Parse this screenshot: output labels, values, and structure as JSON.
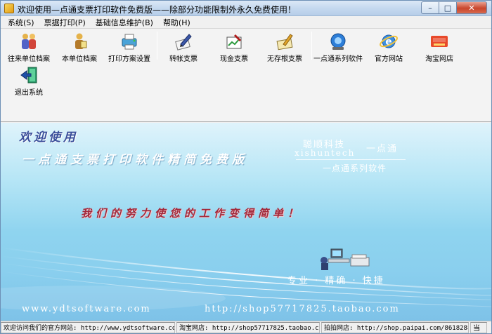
{
  "window": {
    "title": "欢迎使用—点通支票打印软件免费版——除部分功能限制外永久免费使用！",
    "min_glyph": "–",
    "max_glyph": "□",
    "close_glyph": "✕"
  },
  "menu": [
    {
      "label": "系统(S)"
    },
    {
      "label": "票据打印(P)"
    },
    {
      "label": "基础信息维护(B)"
    },
    {
      "label": "帮助(H)"
    }
  ],
  "toolbar": [
    {
      "label": "往来单位档案",
      "icon": "people-icon"
    },
    {
      "label": "本单位档案",
      "icon": "person-icon"
    },
    {
      "label": "打印方案设置",
      "icon": "printer-settings-icon"
    },
    {
      "label": "转帐支票",
      "icon": "transfer-check-icon"
    },
    {
      "label": "现金支票",
      "icon": "cash-check-icon"
    },
    {
      "label": "无存根支票",
      "icon": "stubless-check-icon"
    },
    {
      "label": "一点通系列软件",
      "icon": "software-series-icon"
    },
    {
      "label": "官方网站",
      "icon": "ie-browser-icon"
    },
    {
      "label": "淘宝网店",
      "icon": "taobao-icon"
    },
    {
      "label": "退出系统",
      "icon": "exit-icon"
    }
  ],
  "banner": {
    "welcome": "欢迎使用",
    "subtitle": "一点通支票打印软件精简免费版",
    "company_cn": "聪顺科技",
    "company_en": "xishuntech",
    "brand_short": "一点通",
    "series": "一点通系列软件",
    "slogan": "我们的努力使您的工作变得简单！",
    "tagline": "专业 · 精确 · 快捷",
    "url_site": "www.ydtsoftware.com",
    "url_shop": "http://shop57717825.taobao.com"
  },
  "status": {
    "welcome": "欢迎访问我们的官方网站: http://www.ydtsoftware.com",
    "taobao": "淘宝网店: http://shop57717825.taobao.com",
    "paipai": "拍拍网店: http://shop.paipai.com/861828834",
    "tail": "当"
  },
  "colors": {
    "title_gradient_top": "#dbe8f6",
    "banner_blue": "#8fd4ef",
    "slogan_red": "#a2293b",
    "close_red": "#c9462c"
  }
}
